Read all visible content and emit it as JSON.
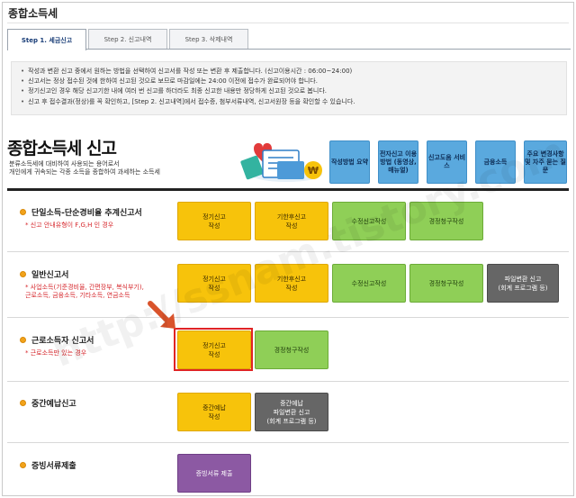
{
  "page_title": "종합소득세",
  "tabs": [
    {
      "label": "Step 1. 세금신고"
    },
    {
      "label": "Step 2. 신고내역"
    },
    {
      "label": "Step 3. 삭제내역"
    }
  ],
  "notices": [
    "작성과 변환 신고 중에서 원하는 방법을 선택하여 신고서를 작성 또는 변환 후 제출합니다. (신고이용시간 : 06:00~24:00)",
    "신고서는 정상 접수된 것에 한하여 신고된 것으로 보므로 마감일에는 24:00 이전에 접수가 완료되어야 합니다.",
    "정기신고인 경우 해당 신고기한 내에 여러 번 신고를 하더라도 최종 신고한 내용만 정당하게 신고된 것으로 봅니다.",
    "신고 후 접수결과(정상)를 꼭 확인하고, [Step 2. 신고내역]에서 접수증, 첨부서류내역, 신고서원장 등을 확인할 수 있습니다."
  ],
  "section": {
    "title": "종합소득세 신고",
    "desc_line1": "분류소득세에 대비하여 사용되는 용어로서",
    "desc_line2": "개인에게 귀속되는 각종 소득을 종합하여 과세하는 소득세"
  },
  "quick_links": [
    {
      "label": "작성방법\n요약"
    },
    {
      "label": "전자신고\n이용방법\n(동영상,\n매뉴얼)"
    },
    {
      "label": "신고도움\n서비스"
    },
    {
      "label": "금융소득"
    },
    {
      "label": "주요\n변경사항 및\n자주 묻는\n질문"
    }
  ],
  "rows": [
    {
      "title": "단일소득-단순경비율 추계신고서",
      "sub": [
        "* 신고 안내유형이 F,G,H 인 경우"
      ],
      "buttons": [
        "정기신고\n작성",
        "기한후신고\n작성",
        "수정신고작성",
        "경정청구작성"
      ]
    },
    {
      "title": "일반신고서",
      "sub": [
        "* 사업소득(기준경비율, 간편장부, 복식부기),",
        "근로소득, 금융소득, 기타소득, 연금소득"
      ],
      "buttons": [
        "정기신고\n작성",
        "기한후신고\n작성",
        "수정신고작성",
        "경정청구작성",
        "파일변환 신고\n(회계 프로그램 등)"
      ]
    },
    {
      "title": "근로소득자 신고서",
      "sub": [
        "* 근로소득만 있는 경우"
      ],
      "buttons": [
        "정기신고\n작성",
        "경정청구작성"
      ]
    },
    {
      "title": "중간예납신고",
      "sub": [],
      "buttons": [
        "중간예납\n작성",
        "중간예납\n파일변환 신고\n(회계 프로그램 등)"
      ]
    },
    {
      "title": "증빙서류제출",
      "sub": [],
      "buttons": [
        "증빙서류 제출"
      ]
    }
  ],
  "watermark": "http://ssnam.tistory.com",
  "colors": {
    "yellow_btn": "#f7c30b",
    "green_btn": "#8fcf57",
    "gray_btn": "#666666",
    "purple_btn": "#8c59a3",
    "quick_link": "#5aa9de",
    "highlight": "#e02424"
  }
}
